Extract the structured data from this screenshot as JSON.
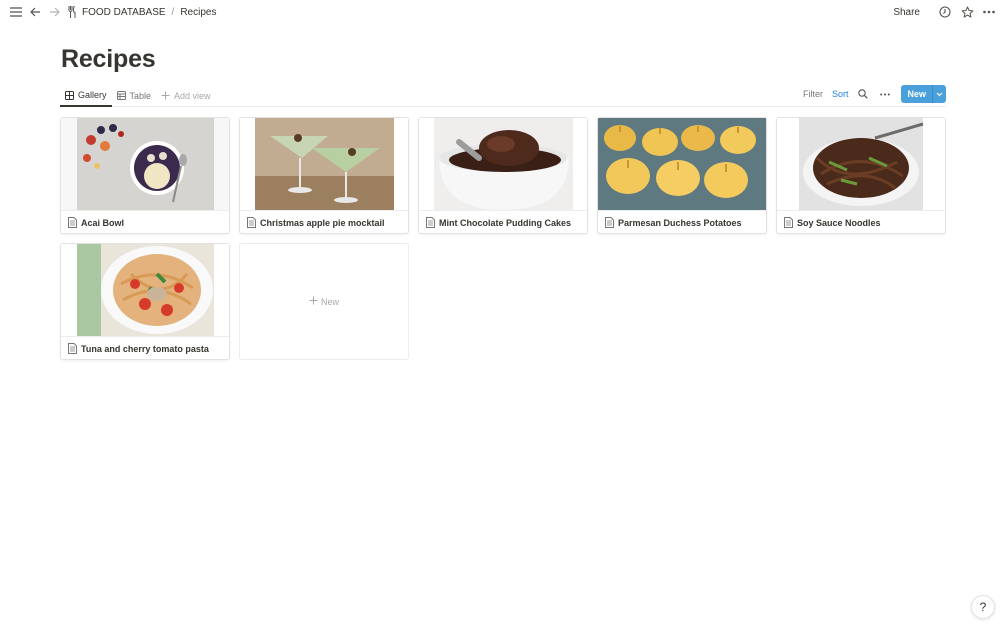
{
  "topbar": {
    "breadcrumb": {
      "database": "FOOD DATABASE",
      "separator": "/",
      "page": "Recipes"
    },
    "share_label": "Share",
    "icons": [
      "menu-icon",
      "back-arrow-icon",
      "forward-arrow-icon",
      "fork-knife-icon",
      "clock-icon",
      "star-icon",
      "more-icon"
    ]
  },
  "page": {
    "title": "Recipes"
  },
  "views": {
    "tabs": [
      {
        "label": "Gallery",
        "icon": "gallery-icon",
        "active": true
      },
      {
        "label": "Table",
        "icon": "table-icon",
        "active": false
      }
    ],
    "add_view": "Add view",
    "filter": "Filter",
    "sort": "Sort",
    "new_label": "New"
  },
  "gallery": {
    "cards": [
      {
        "title": "Acai Bowl"
      },
      {
        "title": "Christmas apple pie mocktail"
      },
      {
        "title": "Mint Chocolate Pudding Cakes"
      },
      {
        "title": "Parmesan Duchess Potatoes"
      },
      {
        "title": "Soy Sauce Noodles"
      },
      {
        "title": "Tuna and cherry tomato pasta"
      }
    ],
    "new_card_label": "New"
  },
  "help_label": "?",
  "colors": {
    "accent": "#2383e2",
    "new_button": "#4aa0db",
    "text": "#37352f",
    "muted": "#787774"
  }
}
